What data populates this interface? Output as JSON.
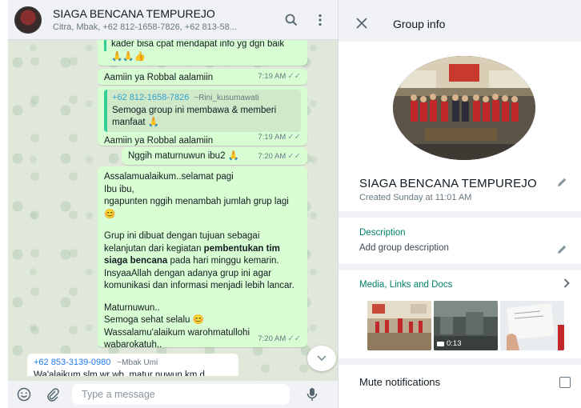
{
  "chat": {
    "title": "SIAGA BENCANA TEMPUREJO",
    "members": "Citra, Mbak, +62 812-1658-7826, +62 813-58...",
    "messages": {
      "m1_text": "kader bisa cpat mendapat info yg dgn baik",
      "m1_emoji": "🙏🙏👍",
      "m2_text": "Aamiin ya Robbal aalamiin",
      "m2_time": "7:19 AM",
      "m3_quote_num": "+62 812-1658-7826",
      "m3_quote_name": "~Rini_kusumawati",
      "m3_quote_text": "Semoga group ini membawa & memberi manfaat 🙏",
      "m3_text": "Aamiin ya Robbal aalamiin",
      "m3_time": "7:19 AM",
      "m4_text": "Nggih maturnuwun ibu2 🙏",
      "m4_time": "7:20 AM",
      "m5_p1": "Assalamualaikum..selamat pagi",
      "m5_p2": "Ibu ibu,",
      "m5_p3": "ngapunten nggih menambah jumlah grup lagi 😊",
      "m5_p4a": "Grup ini dibuat dengan tujuan sebagai kelanjutan dari kegiatan ",
      "m5_p4b": "pembentukan tim siaga bencana",
      "m5_p4c": "  pada hari minggu kemarin. InsyaaAllah dengan adanya grup ini agar komunikasi dan informasi menjadi lebih lancar.",
      "m5_p5": "Maturnuwun..",
      "m5_p6": "Semoga sehat selalu 😊",
      "m5_p7": "Wassalamu'alaikum warohmatullohi wabarokatuh..",
      "m5_time": "7:20 AM",
      "m6_num": "+62 853-3139-0980",
      "m6_name": "~Mbak Umi",
      "m6_text": "Wa'alaikum slm wr wb, matur nuwun km d"
    },
    "compose_placeholder": "Type a message"
  },
  "info": {
    "header_title": "Group info",
    "group_name": "SIAGA BENCANA TEMPUREJO",
    "created": "Created Sunday at 11:01 AM",
    "description_label": "Description",
    "description_value": "Add group description",
    "media_label": "Media, Links and Docs",
    "video_duration": "0:13",
    "mute_label": "Mute notifications"
  },
  "icons": [
    "search-icon",
    "menu-dots-icon",
    "close-icon",
    "pencil-icon",
    "chevron-right-icon",
    "emoji-icon",
    "attach-icon",
    "mic-icon",
    "chevron-down-icon"
  ],
  "colors": {
    "accent": "#008069",
    "bubble_out": "#d9fdd3",
    "panel_bg": "#f0f2f5"
  }
}
